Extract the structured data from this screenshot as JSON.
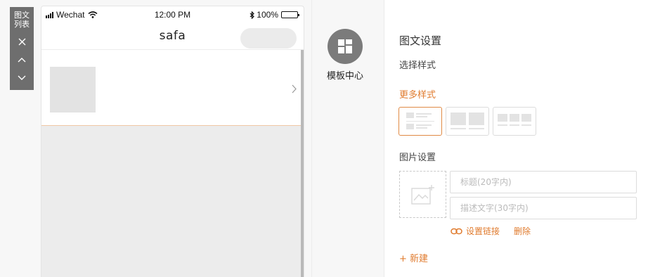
{
  "side_tag": {
    "title": "图文列表",
    "tools": [
      "close-icon",
      "chevron-up-icon",
      "chevron-down-icon"
    ]
  },
  "phone": {
    "status_bar": {
      "carrier": "Wechat",
      "time": "12:00 PM",
      "battery": "100%"
    },
    "nav_title": "safa",
    "item": {
      "arrow_icon": "chevron-right-icon"
    }
  },
  "middle": {
    "template_icon": "grid-icon",
    "template_label": "模板中心"
  },
  "panel": {
    "title": "图文设置",
    "style_label": "选择样式",
    "more_styles": "更多样式",
    "style_options": [
      "list-style-icon",
      "two-column-style-icon",
      "three-column-style-icon"
    ],
    "selected_style": 0,
    "image_settings_label": "图片设置",
    "title_field": {
      "placeholder": "标题(20字内)",
      "value": ""
    },
    "desc_field": {
      "placeholder": "描述文字(30字内)",
      "value": ""
    },
    "set_link": "设置链接",
    "delete": "删除",
    "add_new": "+ 新建"
  },
  "colors": {
    "accent": "#e07b2e",
    "selected_border": "#e08a45",
    "side_tag_bg": "#6e6e6e",
    "template_btn_bg": "#7b7b7b"
  }
}
